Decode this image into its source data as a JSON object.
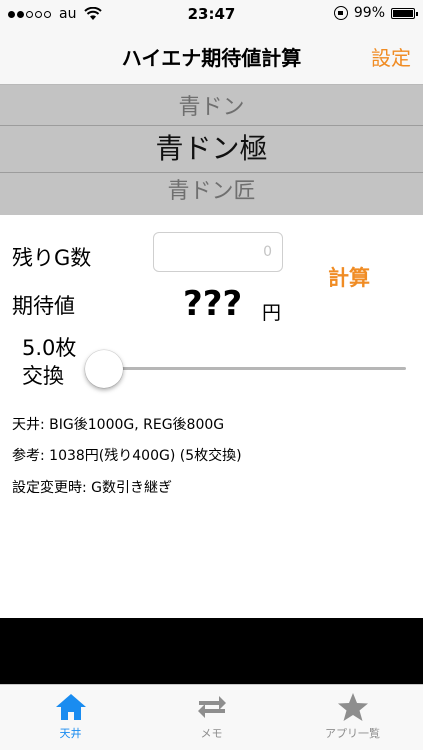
{
  "status_bar": {
    "carrier": "au",
    "time": "23:47",
    "battery": "99%",
    "battery_level": 0.99,
    "signal_bars": 2
  },
  "nav": {
    "title": "ハイエナ期待値計算",
    "settings_label": "設定"
  },
  "picker": {
    "prev": "青ドン",
    "selected": "青ドン極",
    "next": "青ドン匠"
  },
  "form": {
    "remaining_label": "残りG数",
    "remaining_placeholder": "0",
    "calc_label": "計算",
    "expected_label": "期待値",
    "expected_value": "???",
    "yen": "円",
    "exchange_rate": "5.0枚",
    "exchange_label": "交換",
    "slider_value": 0.0
  },
  "info": {
    "ceiling": "天井: BIG後1000G, REG後800G",
    "reference": "参考: 1038円(残り400G) (5枚交換)",
    "on_change": "設定変更時: G数引き継ぎ"
  },
  "tabs": [
    {
      "label": "天井",
      "icon": "home-icon",
      "active": true
    },
    {
      "label": "メモ",
      "icon": "repeat-icon",
      "active": false
    },
    {
      "label": "アプリ一覧",
      "icon": "star-icon",
      "active": false
    }
  ],
  "colors": {
    "accent": "#f08c24",
    "tab_active": "#1a8cf0",
    "tab_inactive": "#8e8e8e"
  }
}
